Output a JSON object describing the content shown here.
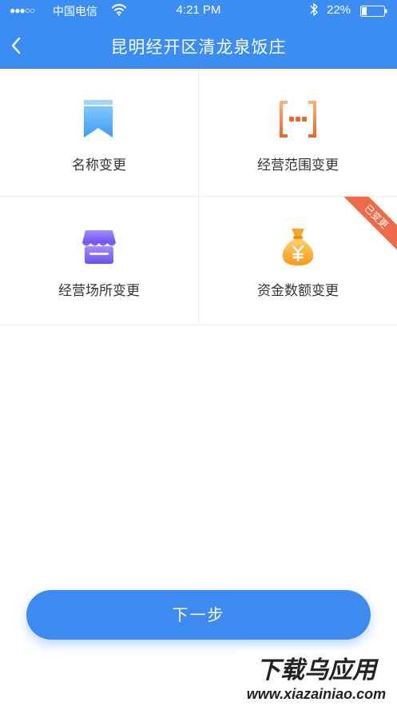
{
  "status_bar": {
    "signal": "●●●○○",
    "carrier": "中国电信",
    "time": "4:21 PM",
    "battery": "22%"
  },
  "nav": {
    "title": "昆明经开区清龙泉饭庄"
  },
  "grid": {
    "items": [
      {
        "label": "名称变更",
        "icon": "bookmark-icon"
      },
      {
        "label": "经营范围变更",
        "icon": "brackets-icon"
      },
      {
        "label": "经营场所变更",
        "icon": "storefront-icon"
      },
      {
        "label": "资金数额变更",
        "icon": "money-bag-icon",
        "badge": "已变更"
      }
    ]
  },
  "next_button": {
    "label": "下一步"
  },
  "watermark": {
    "title": "下载乌应用",
    "url": "www.xiazainiao.com"
  },
  "colors": {
    "header": "#3b8cf3",
    "button": "#3d8bf0",
    "badge": "#f06a4a"
  }
}
